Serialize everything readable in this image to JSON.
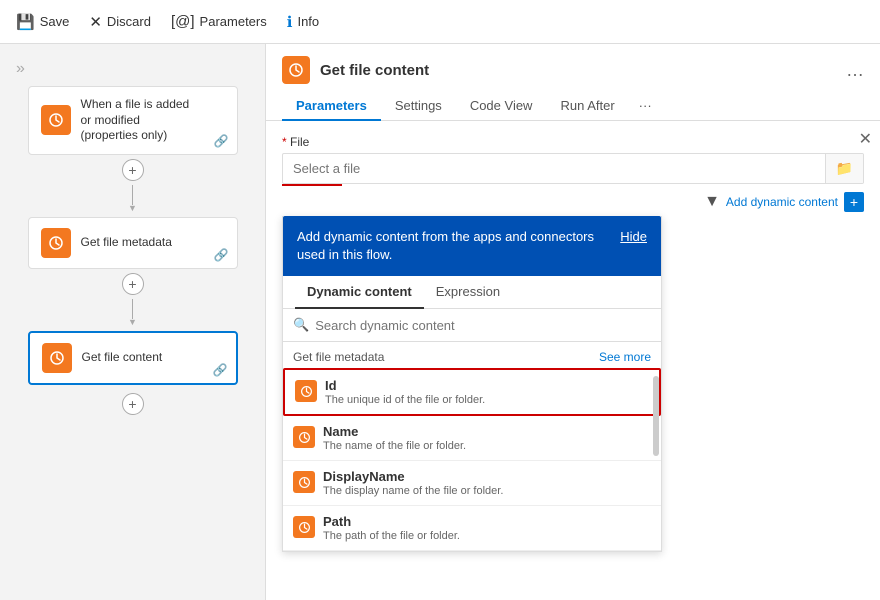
{
  "toolbar": {
    "save_label": "Save",
    "discard_label": "Discard",
    "parameters_label": "Parameters",
    "info_label": "Info"
  },
  "canvas": {
    "nodes": [
      {
        "id": "trigger",
        "label": "When a file is added\nor modified\n(properties only)",
        "active": false
      },
      {
        "id": "metadata",
        "label": "Get file metadata",
        "active": false
      },
      {
        "id": "content",
        "label": "Get file content",
        "active": true
      }
    ]
  },
  "panel": {
    "title": "Get file content",
    "tabs": [
      "Parameters",
      "Settings",
      "Code View",
      "Run After"
    ],
    "active_tab": "Parameters",
    "file_field_label": "* File",
    "file_placeholder": "Select a file",
    "add_dynamic_label": "Add dynamic content",
    "dynamic_banner_text": "Add dynamic content from the apps and connectors used in this flow.",
    "dynamic_banner_hide": "Hide",
    "dynamic_tabs": [
      "Dynamic content",
      "Expression"
    ],
    "active_dynamic_tab": "Dynamic content",
    "search_placeholder": "Search dynamic content",
    "section_label": "Get file metadata",
    "see_more_label": "See more",
    "dynamic_items": [
      {
        "name": "Id",
        "description": "The unique id of the file or folder.",
        "highlighted": true
      },
      {
        "name": "Name",
        "description": "The name of the file or folder.",
        "highlighted": false
      },
      {
        "name": "DisplayName",
        "description": "The display name of the file or folder.",
        "highlighted": false
      },
      {
        "name": "Path",
        "description": "The path of the file or folder.",
        "highlighted": false
      }
    ]
  }
}
